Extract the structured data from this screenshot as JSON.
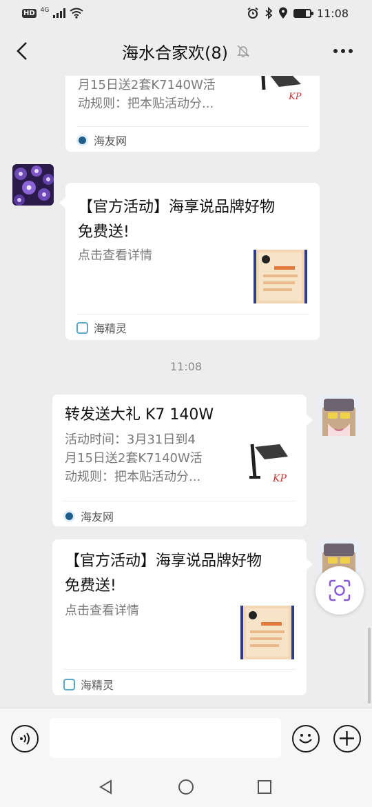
{
  "status_bar": {
    "left_badge": "HD",
    "network": "4G",
    "time": "11:08",
    "battery_level": 0.75
  },
  "header": {
    "title": "海水合家欢(8)",
    "back_icon": "chevron-left-icon",
    "mute_icon": "bell-off-icon",
    "more_icon": "more-dots-icon"
  },
  "messages": [
    {
      "title_lines": [],
      "desc_lines": [
        "月15日送2套K7140W活",
        "动规则：把本贴活动分..."
      ],
      "source": "海友网"
    },
    {
      "title_lines": [
        "【官方活动】海享说品牌好物",
        "免费送!"
      ],
      "desc_lines": [
        "点击查看详情"
      ],
      "source": "海精灵"
    },
    {
      "title_lines": [
        "转发送大礼 K7 140W"
      ],
      "desc_lines": [
        "活动时间：3月31日到4",
        "月15日送2套K7140W活",
        "动规则：把本贴活动分..."
      ],
      "source": "海友网"
    },
    {
      "title_lines": [
        "【官方活动】海享说品牌好物",
        "免费送!"
      ],
      "desc_lines": [
        "点击查看详情"
      ],
      "source": "海精灵"
    }
  ],
  "time_separator": "11:08",
  "thumb_logo_text": "KP",
  "input_bar": {
    "placeholder": "",
    "voice_icon": "voice-icon",
    "emoji_icon": "emoji-icon",
    "plus_icon": "plus-icon"
  },
  "nav": {
    "back_icon": "nav-back-icon",
    "home_icon": "nav-home-icon",
    "recents_icon": "nav-recents-icon"
  },
  "colors": {
    "background": "#ededed",
    "bubble": "#ffffff",
    "secondary_text": "#7a7a7a",
    "accent_purple": "#8a5bd6"
  }
}
